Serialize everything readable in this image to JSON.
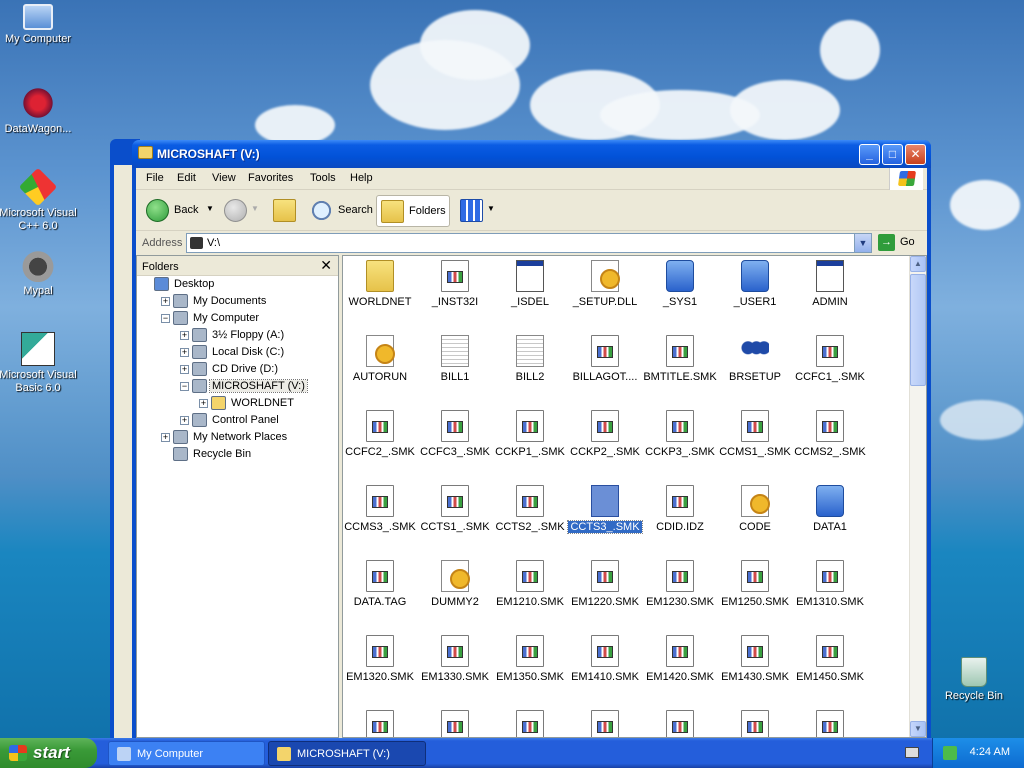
{
  "desktop": {
    "icons": [
      {
        "label": "My Computer"
      },
      {
        "label": "DataWagon..."
      },
      {
        "label": "Microsoft Visual C++ 6.0"
      },
      {
        "label": "Mypal"
      },
      {
        "label": "Microsoft Visual Basic 6.0"
      },
      {
        "label": "Recycle Bin"
      }
    ]
  },
  "window": {
    "title": "MICROSHAFT (V:)",
    "controls": {
      "minimize": "_",
      "maximize": "□",
      "close": "✕"
    },
    "menu": [
      "File",
      "Edit",
      "View",
      "Favorites",
      "Tools",
      "Help"
    ],
    "toolbar": {
      "back": "Back",
      "search": "Search",
      "folders": "Folders"
    },
    "address": {
      "label": "Address",
      "value": "V:\\",
      "go": "Go"
    }
  },
  "folders_pane": {
    "title": "Folders",
    "close": "✕",
    "tree": [
      {
        "label": "Desktop",
        "indent": 0,
        "expander": ""
      },
      {
        "label": "My Documents",
        "indent": 1,
        "expander": "+"
      },
      {
        "label": "My Computer",
        "indent": 1,
        "expander": "−"
      },
      {
        "label": "3½ Floppy (A:)",
        "indent": 2,
        "expander": "+"
      },
      {
        "label": "Local Disk (C:)",
        "indent": 2,
        "expander": "+"
      },
      {
        "label": "CD Drive (D:)",
        "indent": 2,
        "expander": "+"
      },
      {
        "label": "MICROSHAFT (V:)",
        "indent": 2,
        "expander": "−",
        "selected": true
      },
      {
        "label": "WORLDNET",
        "indent": 3,
        "expander": "+"
      },
      {
        "label": "Control Panel",
        "indent": 2,
        "expander": "+"
      },
      {
        "label": "My Network Places",
        "indent": 1,
        "expander": "+"
      },
      {
        "label": "Recycle Bin",
        "indent": 1,
        "expander": ""
      }
    ]
  },
  "files": [
    {
      "name": "WORLDNET",
      "icon": "folder"
    },
    {
      "name": "_INST32I",
      "icon": "doc"
    },
    {
      "name": "_ISDEL",
      "icon": "window"
    },
    {
      "name": "_SETUP.DLL",
      "icon": "gear"
    },
    {
      "name": "_SYS1",
      "icon": "blue"
    },
    {
      "name": "_USER1",
      "icon": "blue"
    },
    {
      "name": "ADMIN",
      "icon": "window"
    },
    {
      "name": "AUTORUN",
      "icon": "gear"
    },
    {
      "name": "BILL1",
      "icon": "text"
    },
    {
      "name": "BILL2",
      "icon": "text"
    },
    {
      "name": "BILLAGOT....",
      "icon": "doc"
    },
    {
      "name": "BMTITLE.SMK",
      "icon": "doc"
    },
    {
      "name": "BRSETUP",
      "icon": "people"
    },
    {
      "name": "CCFC1_.SMK",
      "icon": "doc"
    },
    {
      "name": "CCFC2_.SMK",
      "icon": "doc"
    },
    {
      "name": "CCFC3_.SMK",
      "icon": "doc"
    },
    {
      "name": "CCKP1_.SMK",
      "icon": "doc"
    },
    {
      "name": "CCKP2_.SMK",
      "icon": "doc"
    },
    {
      "name": "CCKP3_.SMK",
      "icon": "doc"
    },
    {
      "name": "CCMS1_.SMK",
      "icon": "doc"
    },
    {
      "name": "CCMS2_.SMK",
      "icon": "doc"
    },
    {
      "name": "CCMS3_.SMK",
      "icon": "doc"
    },
    {
      "name": "CCTS1_.SMK",
      "icon": "doc"
    },
    {
      "name": "CCTS2_.SMK",
      "icon": "doc"
    },
    {
      "name": "CCTS3_.SMK",
      "icon": "doc",
      "selected": true
    },
    {
      "name": "CDID.IDZ",
      "icon": "doc"
    },
    {
      "name": "CODE",
      "icon": "gear"
    },
    {
      "name": "DATA1",
      "icon": "blue"
    },
    {
      "name": "DATA.TAG",
      "icon": "doc"
    },
    {
      "name": "DUMMY2",
      "icon": "gear"
    },
    {
      "name": "EM1210.SMK",
      "icon": "doc"
    },
    {
      "name": "EM1220.SMK",
      "icon": "doc"
    },
    {
      "name": "EM1230.SMK",
      "icon": "doc"
    },
    {
      "name": "EM1250.SMK",
      "icon": "doc"
    },
    {
      "name": "EM1310.SMK",
      "icon": "doc"
    },
    {
      "name": "EM1320.SMK",
      "icon": "doc"
    },
    {
      "name": "EM1330.SMK",
      "icon": "doc"
    },
    {
      "name": "EM1350.SMK",
      "icon": "doc"
    },
    {
      "name": "EM1410.SMK",
      "icon": "doc"
    },
    {
      "name": "EM1420.SMK",
      "icon": "doc"
    },
    {
      "name": "EM1430.SMK",
      "icon": "doc"
    },
    {
      "name": "EM1450.SMK",
      "icon": "doc"
    },
    {
      "name": "",
      "icon": "doc"
    },
    {
      "name": "",
      "icon": "doc"
    },
    {
      "name": "",
      "icon": "doc"
    },
    {
      "name": "",
      "icon": "doc"
    },
    {
      "name": "",
      "icon": "doc"
    },
    {
      "name": "",
      "icon": "doc"
    },
    {
      "name": "",
      "icon": "doc"
    }
  ],
  "taskbar": {
    "start": "start",
    "tasks": [
      {
        "label": "My Computer",
        "active": false
      },
      {
        "label": "MICROSHAFT (V:)",
        "active": true
      }
    ],
    "clock": "4:24 AM"
  }
}
